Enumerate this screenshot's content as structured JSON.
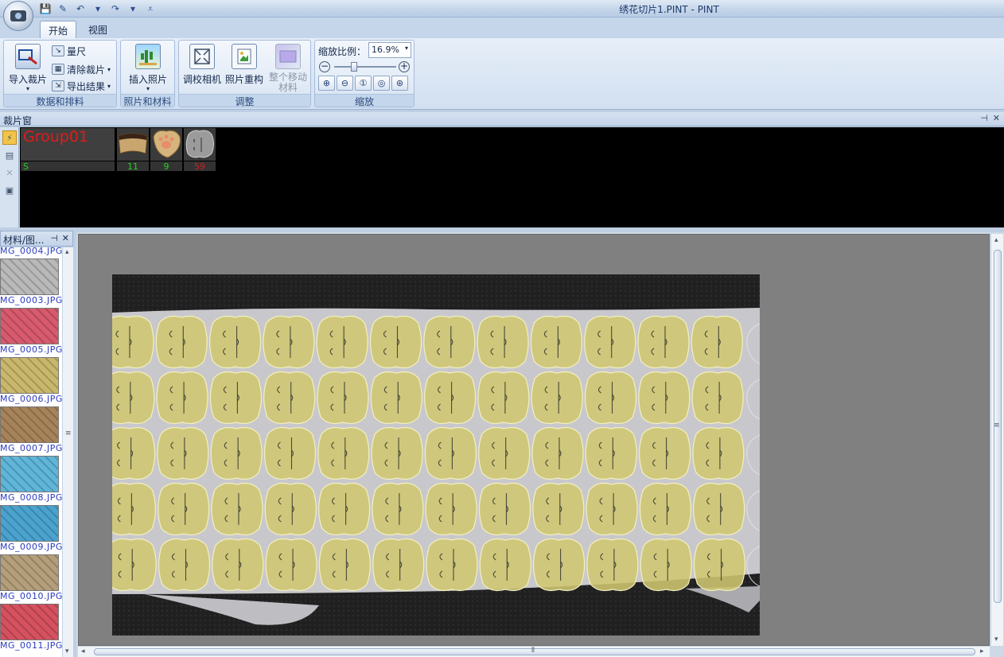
{
  "window": {
    "title": "绣花切片1.PINT - PINT"
  },
  "ribbon": {
    "tabs": [
      "开始",
      "视图"
    ],
    "groups": {
      "data": {
        "label": "数据和排料",
        "import_pieces": "导入裁片",
        "ruler": "量尺",
        "clear_pieces": "清除裁片",
        "export_results": "导出结果"
      },
      "photo": {
        "label": "照片和材料",
        "insert_photo": "插入照片"
      },
      "adjust": {
        "label": "调整",
        "calibrate_camera": "调校相机",
        "photo_reconstruct": "照片重构",
        "move_material": "整个移动材料"
      },
      "zoom": {
        "label": "缩放",
        "ratio_label": "缩放比例：",
        "ratio_value": "16.9%",
        "slider_level": 0.3
      }
    }
  },
  "piece_window": {
    "title": "裁片窗",
    "group": {
      "name": "Group01",
      "size": "S"
    },
    "pieces": [
      {
        "count": "11",
        "count_color": "#22d422",
        "shape": "rect-dark"
      },
      {
        "count": "9",
        "count_color": "#22d422",
        "shape": "paw"
      },
      {
        "count": "59",
        "count_color": "#d41d1d",
        "shape": "round-gray"
      }
    ]
  },
  "materials": {
    "title": "材料/图...",
    "items": [
      {
        "label": "MG_0004.JPG",
        "color": "#9a9a9a"
      },
      {
        "label": "MG_0003.JPG",
        "color": "#b9b9b9"
      },
      {
        "label": "MG_0005.JPG",
        "color": "#d85a6e"
      },
      {
        "label": "MG_0006.JPG",
        "color": "#c9b86c"
      },
      {
        "label": "MG_0007.JPG",
        "color": "#a7835a"
      },
      {
        "label": "MG_0008.JPG",
        "color": "#5fb6d9"
      },
      {
        "label": "MG_0009.JPG",
        "color": "#4aa3cf"
      },
      {
        "label": "MG_0010.JPG",
        "color": "#b59f7b"
      },
      {
        "label": "MG_0011.JPG",
        "color": "#d6515f"
      }
    ]
  },
  "layout_colors": {
    "piece_fill": "#cfc66f",
    "piece_stroke": "#f3efbf",
    "fabric": "#c9c9cf",
    "canvas_bg": "#808080"
  }
}
